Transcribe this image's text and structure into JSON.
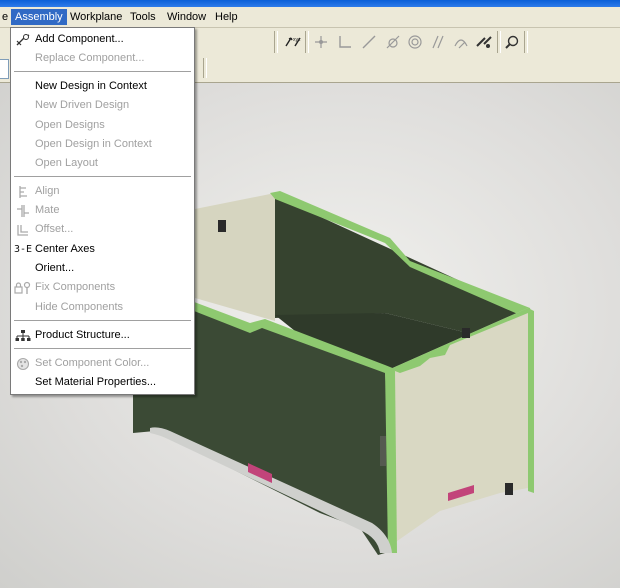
{
  "menubar": {
    "items": [
      {
        "label": "e"
      },
      {
        "label": "Assembly",
        "active": true
      },
      {
        "label": "Workplane"
      },
      {
        "label": "Tools"
      },
      {
        "label": "Window"
      },
      {
        "label": "Help"
      }
    ]
  },
  "assembly_menu": {
    "items": [
      {
        "label": "Add Component...",
        "icon": "add-component-icon",
        "enabled": true
      },
      {
        "label": "Replace Component...",
        "enabled": false
      },
      {
        "label": "New Design in Context",
        "enabled": true
      },
      {
        "label": "New Driven Design",
        "enabled": false
      },
      {
        "label": "Open Designs",
        "enabled": false
      },
      {
        "label": "Open Design in Context",
        "enabled": false
      },
      {
        "label": "Open Layout",
        "enabled": false
      },
      {
        "label": "Align",
        "icon": "align-icon",
        "enabled": false
      },
      {
        "label": "Mate",
        "icon": "mate-icon",
        "enabled": false
      },
      {
        "label": "Offset...",
        "icon": "offset-icon",
        "enabled": false
      },
      {
        "label": "Center Axes",
        "icon": "center-axes-icon",
        "enabled": true
      },
      {
        "label": "Orient...",
        "enabled": true
      },
      {
        "label": "Fix Components",
        "icon": "fix-components-icon",
        "enabled": false
      },
      {
        "label": "Hide Components",
        "enabled": false
      },
      {
        "label": "Product Structure...",
        "icon": "product-structure-icon",
        "enabled": true
      },
      {
        "label": "Set Component Color...",
        "icon": "component-color-icon",
        "enabled": false
      },
      {
        "label": "Set Material Properties...",
        "enabled": true
      }
    ]
  },
  "toolbar": {
    "icons": [
      "measure-icon",
      "point-icon",
      "angle-icon",
      "line-icon",
      "tangent-icon",
      "concentric-icon",
      "parallel-icon",
      "arc-icon",
      "dimension-icon",
      "zoom-icon"
    ]
  },
  "colors": {
    "menu_highlight": "#316ac5",
    "panel_dark": "#3b4a35",
    "panel_light": "#d9d8c3",
    "edge_green": "#8ec970",
    "slot_magenta": "#c2447a"
  }
}
